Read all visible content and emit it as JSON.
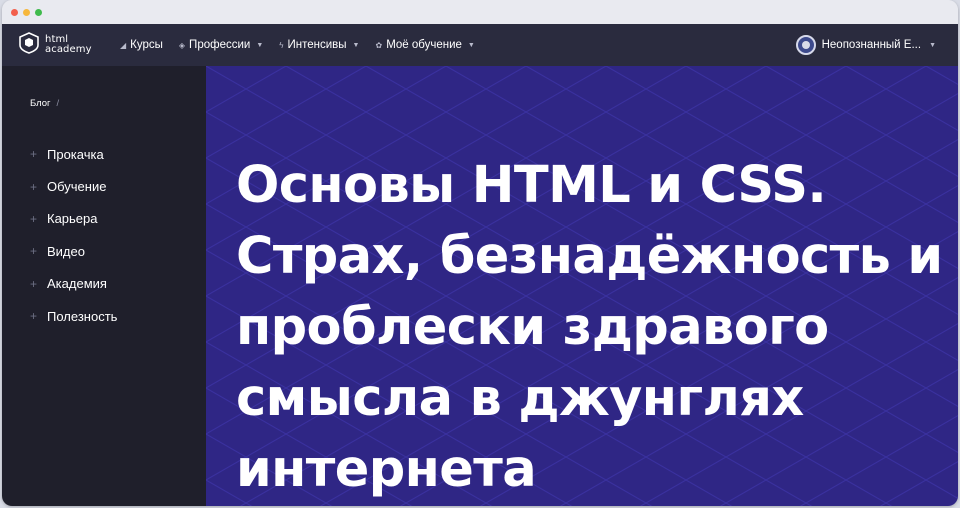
{
  "logo": {
    "line1": "html",
    "line2": "academy",
    "icon": "html-academy-shield-icon"
  },
  "nav": [
    {
      "icon": "courses-icon",
      "glyph": "◢",
      "label": "Курсы",
      "dropdown": false
    },
    {
      "icon": "professions-icon",
      "glyph": "◈",
      "label": "Профессии",
      "dropdown": true
    },
    {
      "icon": "lightning-icon",
      "glyph": "ϟ",
      "label": "Интенсивы",
      "dropdown": true
    },
    {
      "icon": "my-learning-icon",
      "glyph": "✿",
      "label": "Моё обучение",
      "dropdown": true
    }
  ],
  "user": {
    "name": "Неопознанный Е...",
    "dropdown": true
  },
  "sidebar": {
    "breadcrumb": "Блог",
    "breadcrumb_sep": "/",
    "items": [
      {
        "label": "Прокачка"
      },
      {
        "label": "Обучение"
      },
      {
        "label": "Карьера"
      },
      {
        "label": "Видео"
      },
      {
        "label": "Академия"
      },
      {
        "label": "Полезность"
      }
    ]
  },
  "hero": {
    "title": "Основы HTML и CSS. Страх, безнадёжность и проблески здравого смысла в джунглях интернета"
  },
  "colors": {
    "topbar": "#2a2b3e",
    "sidebar": "#1f1f2b",
    "hero": "#2f2685"
  }
}
